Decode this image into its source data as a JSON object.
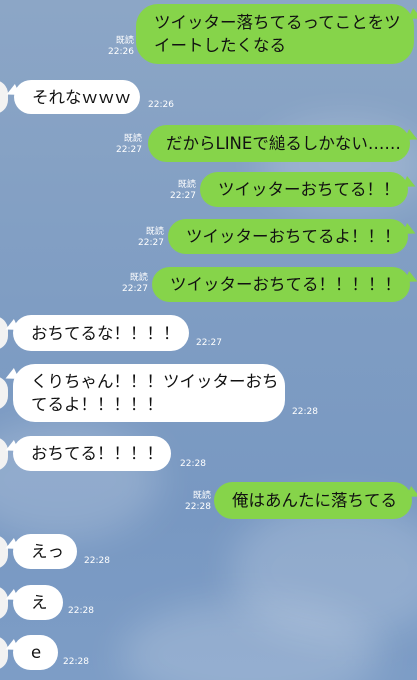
{
  "messages": [
    {
      "side": "right",
      "lines": [
        "ツイッター落ちてるってことをツ",
        "イートしたくなる"
      ],
      "read": "既読",
      "time": "22:26"
    },
    {
      "side": "left",
      "lines": [
        "それなｗｗｗ"
      ],
      "time": "22:26"
    },
    {
      "side": "right",
      "lines": [
        "だからLINEで縋るしかない……"
      ],
      "read": "既読",
      "time": "22:27"
    },
    {
      "side": "right",
      "lines": [
        "ツイッターおちてる！！"
      ],
      "read": "既読",
      "time": "22:27"
    },
    {
      "side": "right",
      "lines": [
        "ツイッターおちてるよ！！！"
      ],
      "read": "既読",
      "time": "22:27"
    },
    {
      "side": "right",
      "lines": [
        "ツイッターおちてる！！！！！"
      ],
      "read": "既読",
      "time": "22:27"
    },
    {
      "side": "left",
      "lines": [
        "おちてるな！！！！"
      ],
      "time": "22:27"
    },
    {
      "side": "left",
      "lines": [
        "くりちゃん！！！ツイッターおち",
        "てるよ！！！！！"
      ],
      "time": "22:28"
    },
    {
      "side": "left",
      "lines": [
        "おちてる！！！！"
      ],
      "time": "22:28"
    },
    {
      "side": "right",
      "lines": [
        "俺はあんたに落ちてる"
      ],
      "read": "既読",
      "time": "22:28"
    },
    {
      "side": "left",
      "lines": [
        "えっ"
      ],
      "time": "22:28"
    },
    {
      "side": "left",
      "lines": [
        "え"
      ],
      "time": "22:28"
    },
    {
      "side": "left",
      "lines": [
        "e"
      ],
      "time": "22:28"
    }
  ]
}
